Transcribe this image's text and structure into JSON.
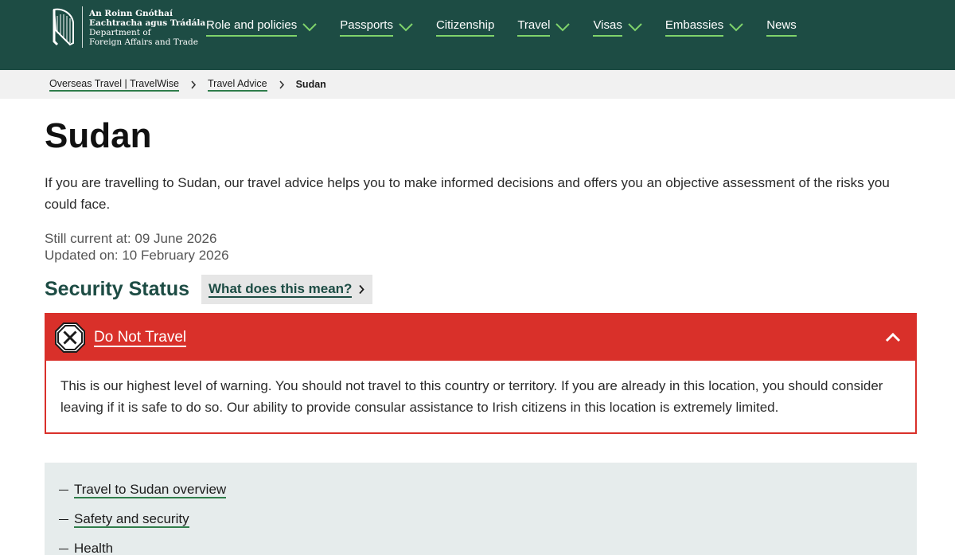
{
  "header": {
    "logo": {
      "line1": "An Roinn Gnóthaí",
      "line2": "Eachtracha agus Trádála",
      "line3": "Department of",
      "line4": "Foreign Affairs and Trade"
    },
    "nav": [
      {
        "label": "Role and policies",
        "dropdown": true
      },
      {
        "label": "Passports",
        "dropdown": true
      },
      {
        "label": "Citizenship",
        "dropdown": false
      },
      {
        "label": "Travel",
        "dropdown": true
      },
      {
        "label": "Visas",
        "dropdown": true
      },
      {
        "label": "Embassies",
        "dropdown": true
      },
      {
        "label": "News",
        "dropdown": false
      }
    ]
  },
  "breadcrumb": {
    "items": [
      "Overseas Travel | TravelWise",
      "Travel Advice"
    ],
    "current": "Sudan"
  },
  "page": {
    "title": "Sudan",
    "intro": "If you are travelling to Sudan, our travel advice helps you to make informed decisions and offers you an objective assessment of the risks you could face.",
    "still_current": "Still current at: 09 June 2026",
    "updated_on": "Updated on: 10 February 2026"
  },
  "security": {
    "title": "Security Status",
    "meaning_link": "What does this mean?",
    "level": "Do Not Travel",
    "description": "This is our highest level of warning. You should not travel to this country or territory. If you are already in this location, you should consider leaving if it is safe to do so. Our ability to provide consular assistance to Irish citizens in this location is extremely limited."
  },
  "toc": [
    "Travel to Sudan overview",
    "Safety and security",
    "Health"
  ],
  "colors": {
    "header_bg": "#1d4c44",
    "accent_green": "#7fd36b",
    "alert_red": "#d9302a",
    "toc_bg": "#e6ecec"
  }
}
